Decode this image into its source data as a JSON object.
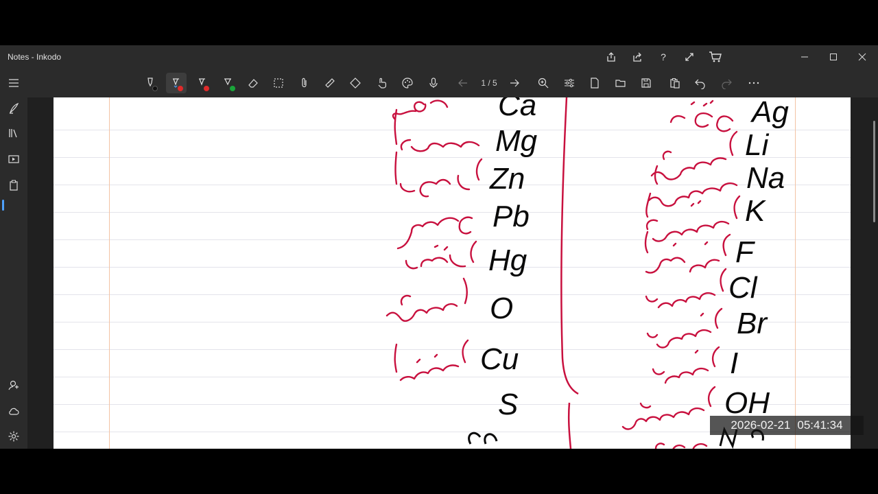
{
  "window": {
    "title": "Notes - Inkodo"
  },
  "toolbar": {
    "page_indicator": "1 / 5"
  },
  "colors": {
    "ink_black": "#0a0a0a",
    "ink_red": "#c8103e",
    "pen_red": "#e02a2a",
    "pen_green": "#1aa53a",
    "accent": "#4ea1ff"
  },
  "tools": [
    "pen-black",
    "pen-red",
    "highlighter-red",
    "highlighter-green",
    "eraser",
    "lasso-select",
    "attach",
    "ruler",
    "shapes",
    "touch-write",
    "color-palette",
    "microphone",
    "previous-page",
    "next-page",
    "zoom",
    "settings",
    "new-page",
    "open",
    "save",
    "paste",
    "undo",
    "redo",
    "more"
  ],
  "sidebar": [
    "pen-tools",
    "library",
    "slideshow",
    "clipboard",
    "feedback",
    "cloud",
    "settings"
  ],
  "notes": {
    "left_column": [
      "Ca",
      "Mg",
      "Zn",
      "Pb",
      "Hg",
      "O",
      "Cu",
      "S"
    ],
    "right_column": [
      "Ag",
      "Li",
      "Na",
      "K",
      "F",
      "Cl",
      "Br",
      "I",
      "OH"
    ]
  },
  "overlay": {
    "date": "2026-02-21",
    "time": "05:41:34"
  }
}
